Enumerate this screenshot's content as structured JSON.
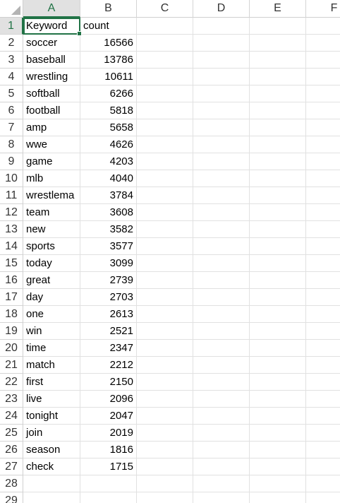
{
  "columns": [
    "A",
    "B",
    "C",
    "D",
    "E",
    "F"
  ],
  "rows": [
    {
      "n": "1",
      "a": "Keyword",
      "b": "count"
    },
    {
      "n": "2",
      "a": "soccer",
      "b": "16566"
    },
    {
      "n": "3",
      "a": "baseball",
      "b": "13786"
    },
    {
      "n": "4",
      "a": "wrestling",
      "b": "10611"
    },
    {
      "n": "5",
      "a": "softball",
      "b": "6266"
    },
    {
      "n": "6",
      "a": "football",
      "b": "5818"
    },
    {
      "n": "7",
      "a": "amp",
      "b": "5658"
    },
    {
      "n": "8",
      "a": "wwe",
      "b": "4626"
    },
    {
      "n": "9",
      "a": "game",
      "b": "4203"
    },
    {
      "n": "10",
      "a": "mlb",
      "b": "4040"
    },
    {
      "n": "11",
      "a": "wrestlema",
      "b": "3784"
    },
    {
      "n": "12",
      "a": "team",
      "b": "3608"
    },
    {
      "n": "13",
      "a": "new",
      "b": "3582"
    },
    {
      "n": "14",
      "a": "sports",
      "b": "3577"
    },
    {
      "n": "15",
      "a": "today",
      "b": "3099"
    },
    {
      "n": "16",
      "a": "great",
      "b": "2739"
    },
    {
      "n": "17",
      "a": "day",
      "b": "2703"
    },
    {
      "n": "18",
      "a": "one",
      "b": "2613"
    },
    {
      "n": "19",
      "a": "win",
      "b": "2521"
    },
    {
      "n": "20",
      "a": "time",
      "b": "2347"
    },
    {
      "n": "21",
      "a": "match",
      "b": "2212"
    },
    {
      "n": "22",
      "a": "first",
      "b": "2150"
    },
    {
      "n": "23",
      "a": "live",
      "b": "2096"
    },
    {
      "n": "24",
      "a": "tonight",
      "b": "2047"
    },
    {
      "n": "25",
      "a": "join",
      "b": "2019"
    },
    {
      "n": "26",
      "a": "season",
      "b": "1816"
    },
    {
      "n": "27",
      "a": "check",
      "b": "1715"
    },
    {
      "n": "28",
      "a": "",
      "b": ""
    },
    {
      "n": "29",
      "a": "",
      "b": ""
    }
  ],
  "active_cell": "A1",
  "accent_color": "#217346"
}
